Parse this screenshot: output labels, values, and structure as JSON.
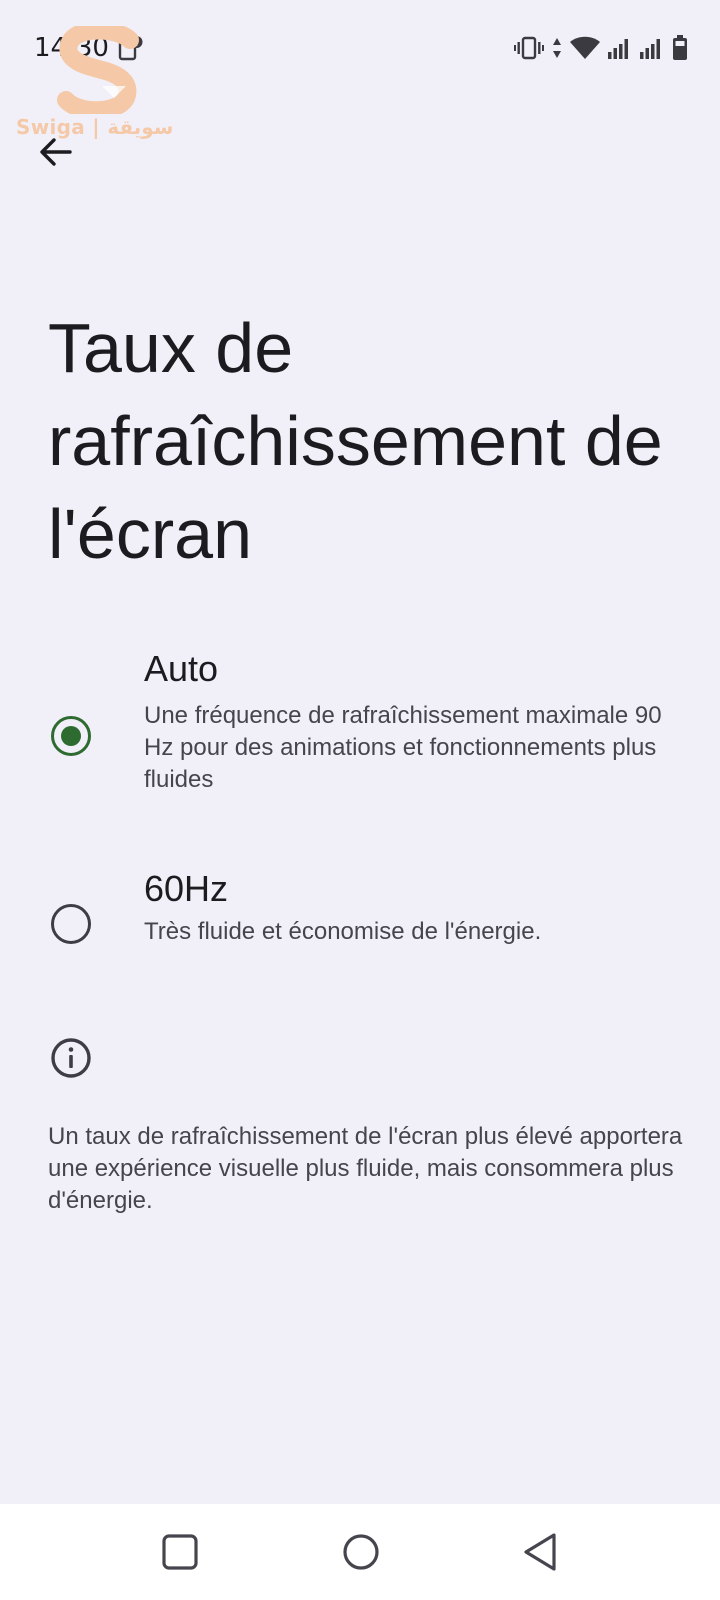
{
  "status_bar": {
    "time": "14:30",
    "icons": [
      "notification-icon",
      "vibrate-icon",
      "data-transfer-icon",
      "wifi-icon",
      "signal-icon",
      "signal-icon",
      "battery-icon"
    ]
  },
  "watermark": {
    "text": "Swiga | سويقة"
  },
  "header": {
    "back_icon": "arrow-back-icon"
  },
  "page": {
    "title": "Taux de rafraîchissement de l'écran"
  },
  "options": [
    {
      "title": "Auto",
      "description": "Une fréquence de rafraîchissement maximale 90 Hz pour des animations et fonctionnements plus fluides",
      "selected": true
    },
    {
      "title": "60Hz",
      "description": "Très fluide et économise de l'énergie.",
      "selected": false
    }
  ],
  "info": {
    "icon": "info-icon",
    "text": "Un taux de rafraîchissement de l'écran plus élevé apportera une expérience visuelle plus fluide, mais consommera plus d'énergie."
  },
  "nav_bar": {
    "icons": [
      "recents-icon",
      "home-icon",
      "back-icon"
    ]
  },
  "colors": {
    "background": "#F1F0F8",
    "accent": "#2E6B30",
    "text_primary": "#1C1B1F",
    "text_secondary": "#46454E",
    "watermark": "#F5C9A8"
  }
}
